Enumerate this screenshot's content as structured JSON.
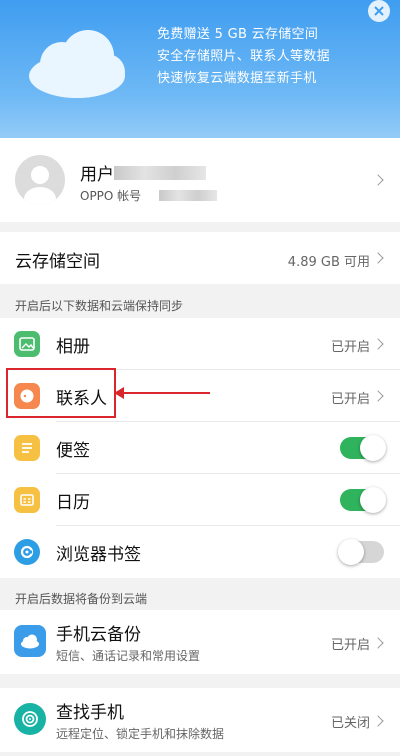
{
  "banner": {
    "line1": "免费赠送 5 GB 云存储空间",
    "line2": "安全存储照片、联系人等数据",
    "line3": "快速恢复云端数据至新手机"
  },
  "account": {
    "name_prefix": "用户",
    "subtitle": "OPPO 帐号"
  },
  "storage": {
    "title": "云存储空间",
    "value": "4.89 GB 可用"
  },
  "sync_section": {
    "header": "开启后以下数据和云端保持同步",
    "items": [
      {
        "label": "相册",
        "status": "已开启",
        "icon": "photo-icon",
        "color": "#4cbd6e"
      },
      {
        "label": "联系人",
        "status": "已开启",
        "icon": "contacts-icon",
        "color": "#f5874f"
      },
      {
        "label": "便签",
        "toggle": "on",
        "icon": "note-icon",
        "color": "#f6c142"
      },
      {
        "label": "日历",
        "toggle": "on",
        "icon": "calendar-icon",
        "color": "#f6c142"
      },
      {
        "label": "浏览器书签",
        "toggle": "off",
        "icon": "browser-icon",
        "color": "#2d9de4"
      }
    ]
  },
  "backup_section": {
    "header": "开启后数据将备份到云端",
    "item": {
      "label": "手机云备份",
      "sub": "短信、通话记录和常用设置",
      "status": "已开启",
      "icon": "cloud-backup-icon",
      "color": "#3b9de9"
    }
  },
  "find_phone": {
    "label": "查找手机",
    "sub": "远程定位、锁定手机和抹除数据",
    "status": "已关闭",
    "icon": "find-phone-icon",
    "color": "#19b3a6"
  },
  "colors": {
    "accent": "#2fb35c",
    "annotation": "#d9262c",
    "banner": "#3f9df0"
  }
}
